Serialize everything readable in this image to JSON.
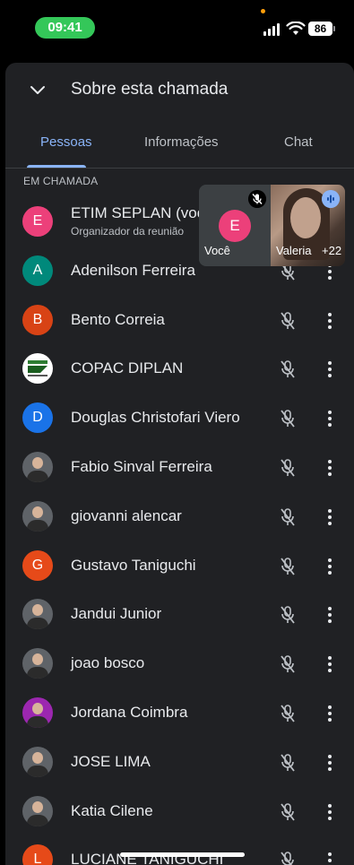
{
  "status_bar": {
    "time": "09:41",
    "battery": "86"
  },
  "header": {
    "title": "Sobre esta chamada"
  },
  "tabs": [
    {
      "label": "Pessoas"
    },
    {
      "label": "Informações"
    },
    {
      "label": "Chat"
    }
  ],
  "section_label": "EM CHAMADA",
  "participants": [
    {
      "initial": "E",
      "color": "#ec407a",
      "name": "ETIM SEPLAN (você)",
      "subtitle": "Organizador da reunião"
    },
    {
      "initial": "A",
      "color": "#00897b",
      "name": "Adenilson Ferreira"
    },
    {
      "initial": "B",
      "color": "#d84315",
      "name": "Bento Correia"
    },
    {
      "initial": "",
      "color": "#ffffff",
      "name": "COPAC DIPLAN"
    },
    {
      "initial": "D",
      "color": "#1a73e8",
      "name": "Douglas Christofari Viero"
    },
    {
      "initial": "",
      "color": "#5f6368",
      "name": "Fabio Sinval Ferreira"
    },
    {
      "initial": "",
      "color": "#5f6368",
      "name": "giovanni alencar"
    },
    {
      "initial": "G",
      "color": "#e64a19",
      "name": "Gustavo Taniguchi"
    },
    {
      "initial": "",
      "color": "#5f6368",
      "name": "Jandui Junior"
    },
    {
      "initial": "",
      "color": "#5f6368",
      "name": "joao bosco"
    },
    {
      "initial": "",
      "color": "#9c27b0",
      "name": "Jordana Coimbra"
    },
    {
      "initial": "",
      "color": "#5f6368",
      "name": "JOSE LIMA"
    },
    {
      "initial": "",
      "color": "#5f6368",
      "name": "Katia Cilene"
    },
    {
      "initial": "L",
      "color": "#e64a19",
      "name": "LUCIANE TANIGUCHI"
    }
  ],
  "pip": {
    "self_initial": "E",
    "self_label": "Você",
    "other_label": "Valeria",
    "others_count": "+22"
  }
}
